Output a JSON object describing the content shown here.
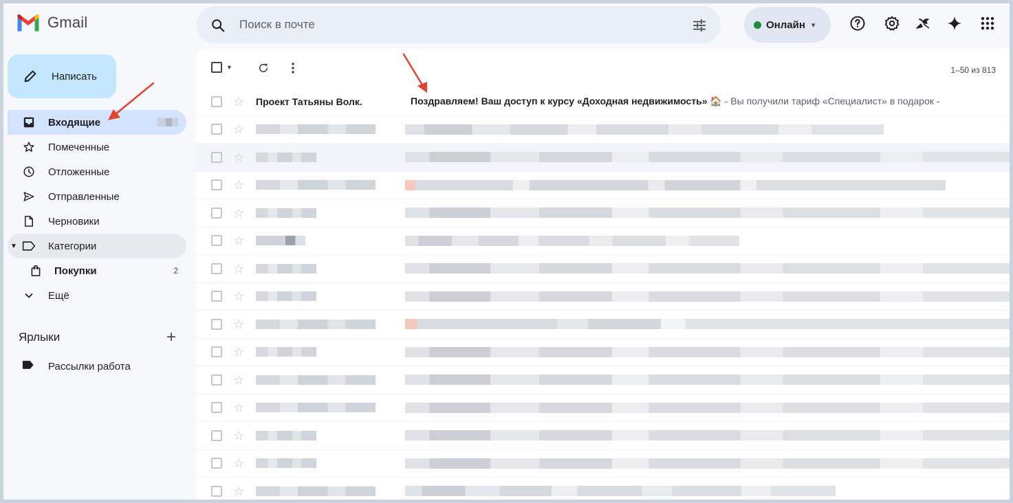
{
  "app": {
    "name": "Gmail"
  },
  "search": {
    "placeholder": "Поиск в почте"
  },
  "status": {
    "label": "Онлайн",
    "color": "#1e8e3e"
  },
  "header_icons": [
    "help-icon",
    "settings-icon",
    "gemini-features-icon",
    "gemini-icon",
    "apps-icon"
  ],
  "compose": {
    "label": "Написать"
  },
  "nav": [
    {
      "label": "Входящие",
      "icon": "inbox-icon",
      "active": true
    },
    {
      "label": "Помеченные",
      "icon": "star-icon"
    },
    {
      "label": "Отложенные",
      "icon": "clock-icon"
    },
    {
      "label": "Отправленные",
      "icon": "send-icon"
    },
    {
      "label": "Черновики",
      "icon": "draft-icon"
    },
    {
      "label": "Категории",
      "icon": "label-outline-icon"
    },
    {
      "label": "Покупки",
      "icon": "shopping-bag-icon",
      "count": "2"
    },
    {
      "label": "Ещё",
      "icon": "chevron-down-icon"
    }
  ],
  "labels": {
    "heading": "Ярлыки",
    "items": [
      {
        "label": "Рассылки работа"
      }
    ]
  },
  "toolbar": {
    "pager": "1–50 из 813"
  },
  "emails": [
    {
      "sender": "Проект Татьяны Волк.",
      "subject": "Поздравляем! Ваш доступ к курсу «Доходная недвижимость» 🏠",
      "snippet": " - Вы получили тариф «Специалист» в подарок -"
    }
  ],
  "accent_colors": {
    "compose_bg": "#c2e7ff",
    "active_nav_bg": "#d3e3fd",
    "annotation_arrow": "#e0432f"
  }
}
